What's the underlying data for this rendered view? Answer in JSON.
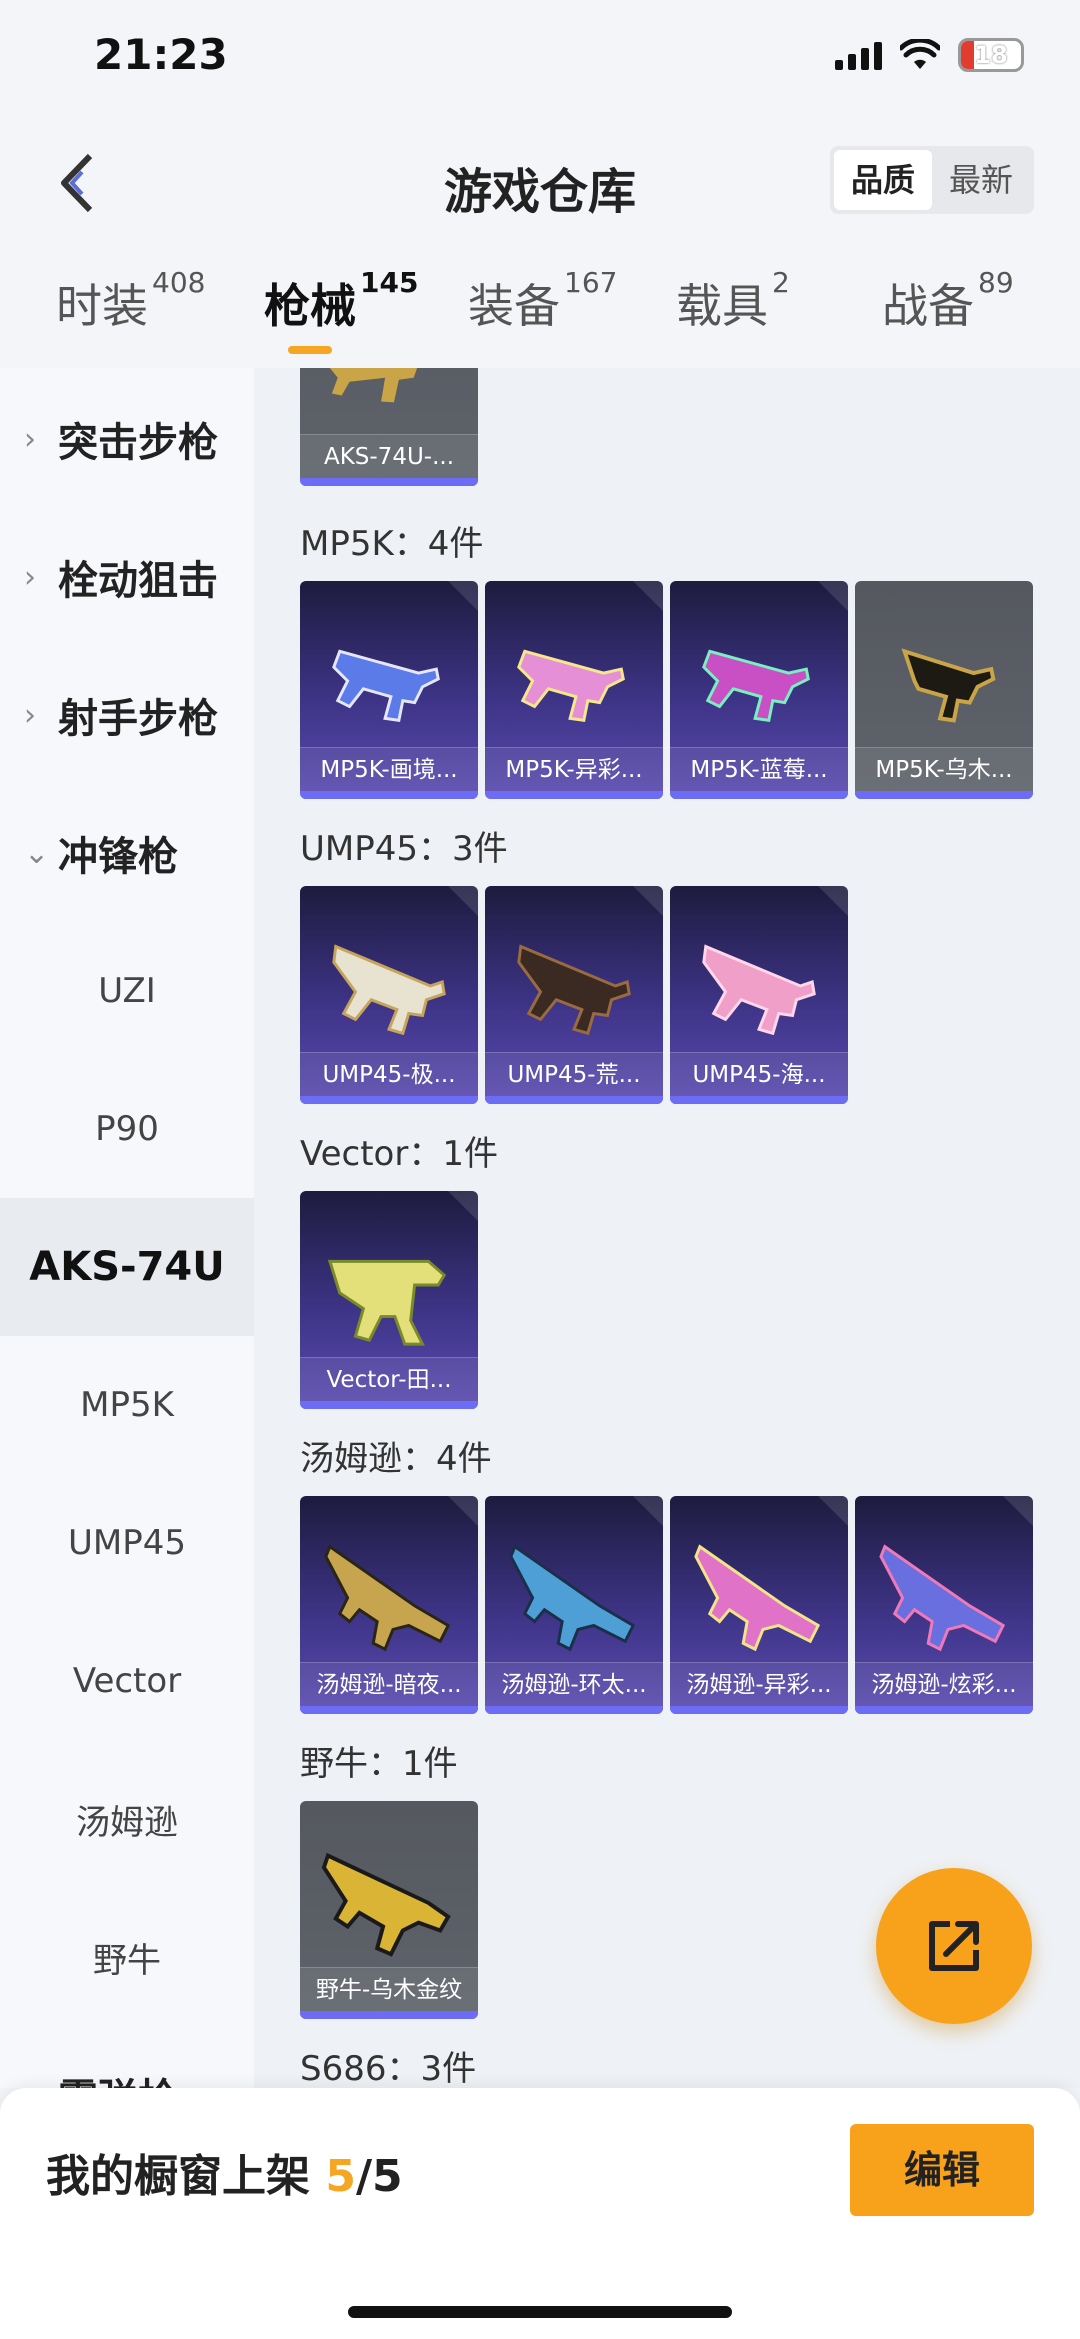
{
  "status": {
    "time": "21:23",
    "battery": "18"
  },
  "header": {
    "title": "游戏仓库",
    "sort_quality": "品质",
    "sort_newest": "最新"
  },
  "tabs": [
    {
      "label": "时装",
      "count": "408"
    },
    {
      "label": "枪械",
      "count": "145"
    },
    {
      "label": "装备",
      "count": "167"
    },
    {
      "label": "载具",
      "count": "2"
    },
    {
      "label": "战备",
      "count": "89"
    }
  ],
  "sidebar": {
    "groups": [
      "突击步枪",
      "栓动狙击",
      "射手步枪",
      "冲锋枪"
    ],
    "items": [
      "UZI",
      "P90",
      "AKS-74U",
      "MP5K",
      "UMP45",
      "Vector",
      "汤姆逊",
      "野牛"
    ],
    "next_group": "霰弹枪"
  },
  "sections": [
    {
      "label": "",
      "items": [
        "AKS-74U-..."
      ]
    },
    {
      "label": "MP5K：4件",
      "items": [
        "MP5K-画境...",
        "MP5K-异彩...",
        "MP5K-蓝莓...",
        "MP5K-乌木..."
      ]
    },
    {
      "label": "UMP45：3件",
      "items": [
        "UMP45-极...",
        "UMP45-荒...",
        "UMP45-海..."
      ]
    },
    {
      "label": "Vector：1件",
      "items": [
        "Vector-田..."
      ]
    },
    {
      "label": "汤姆逊：4件",
      "items": [
        "汤姆逊-暗夜...",
        "汤姆逊-环太...",
        "汤姆逊-异彩...",
        "汤姆逊-炫彩..."
      ]
    },
    {
      "label": "野牛：1件",
      "items": [
        "野牛-乌木金纹"
      ]
    },
    {
      "label": "S686：3件",
      "items": []
    }
  ],
  "bottom": {
    "showcase_label": "我的橱窗上架",
    "showcase_count": "5",
    "showcase_sep": "/",
    "showcase_total": "5",
    "edit": "编辑"
  },
  "colors": {
    "accent": "#f7a21a",
    "card_purple": "#3e3487",
    "card_gray": "#5f636b"
  }
}
